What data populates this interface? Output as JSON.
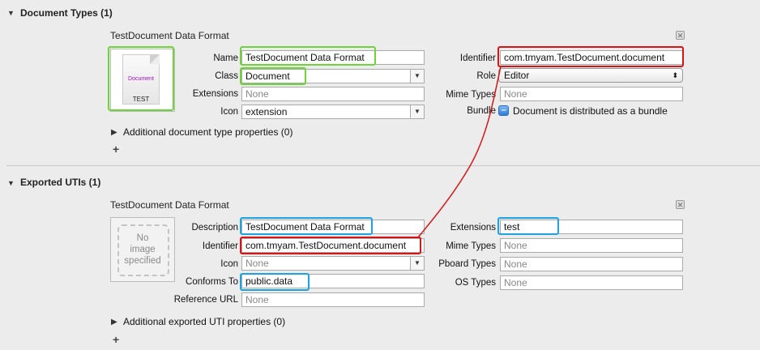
{
  "document_types": {
    "header": "Document Types (1)",
    "entry_title": "TestDocument Data Format",
    "icon_doc_text": "Document",
    "icon_label": "TEST",
    "labels": {
      "name": "Name",
      "class": "Class",
      "extensions": "Extensions",
      "icon": "Icon",
      "identifier": "Identifier",
      "role": "Role",
      "mime_types": "Mime Types",
      "bundle": "Bundle"
    },
    "values": {
      "name": "TestDocument Data Format",
      "class": "Document",
      "extensions_placeholder": "None",
      "icon": "extension",
      "identifier": "com.tmyam.TestDocument.document",
      "role": "Editor",
      "mime_types_placeholder": "None"
    },
    "bundle_text": "Document is distributed as a bundle",
    "additional": "Additional document type properties (0)",
    "add": "+"
  },
  "exported_utis": {
    "header": "Exported UTIs (1)",
    "entry_title": "TestDocument Data Format",
    "no_image": [
      "No",
      "image",
      "specified"
    ],
    "labels": {
      "description": "Description",
      "identifier": "Identifier",
      "icon": "Icon",
      "conforms_to": "Conforms To",
      "reference_url": "Reference URL",
      "extensions": "Extensions",
      "mime_types": "Mime Types",
      "pboard_types": "Pboard Types",
      "os_types": "OS Types"
    },
    "values": {
      "description": "TestDocument Data Format",
      "identifier": "com.tmyam.TestDocument.document",
      "icon_placeholder": "None",
      "conforms_to": "public.data",
      "reference_url_placeholder": "None",
      "extensions": "test",
      "mime_types_placeholder": "None",
      "pboard_types_placeholder": "None",
      "os_types_placeholder": "None"
    },
    "additional": "Additional exported UTI properties (0)",
    "add": "+"
  },
  "colors": {
    "green": "#6fd33a",
    "red": "#d61616",
    "blue": "#1fa3e0"
  }
}
